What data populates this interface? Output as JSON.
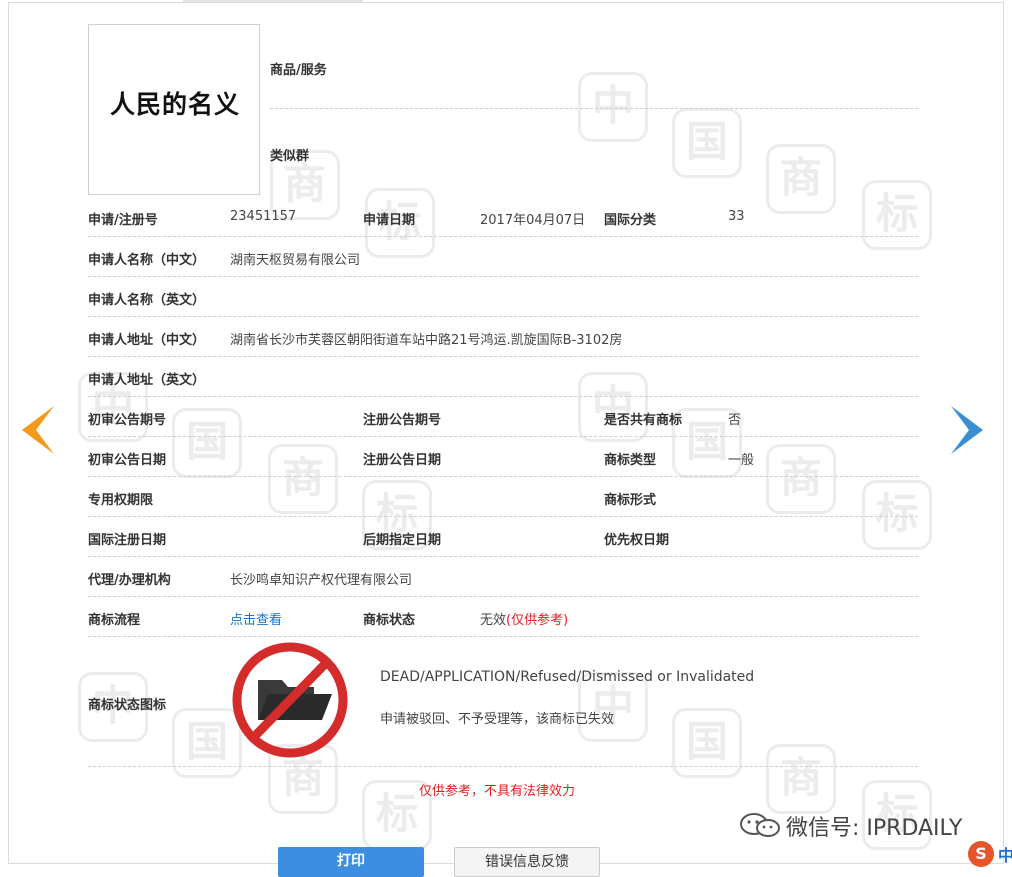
{
  "logo": {
    "text": "人民的名义"
  },
  "goods": {
    "label": "商品/服务",
    "similar_label": "类似群"
  },
  "fields": {
    "reg_no_label": "申请/注册号",
    "reg_no": "23451157",
    "apply_date_label": "申请日期",
    "apply_date": "2017年04月07日",
    "intl_class_label": "国际分类",
    "intl_class": "33",
    "applicant_cn_label": "申请人名称（中文）",
    "applicant_cn": "湖南天枢贸易有限公司",
    "applicant_en_label": "申请人名称（英文）",
    "address_cn_label": "申请人地址（中文）",
    "address_cn": "湖南省长沙市芙蓉区朝阳街道车站中路21号鸿运.凯旋国际B-3102房",
    "address_en_label": "申请人地址（英文）",
    "prelim_no_label": "初审公告期号",
    "reg_pub_no_label": "注册公告期号",
    "shared_label": "是否共有商标",
    "shared": "否",
    "prelim_date_label": "初审公告日期",
    "reg_pub_date_label": "注册公告日期",
    "mark_type_label": "商标类型",
    "mark_type": "一般",
    "exclusive_label": "专用权期限",
    "mark_form_label": "商标形式",
    "intl_reg_date_label": "国际注册日期",
    "later_date_label": "后期指定日期",
    "priority_label": "优先权日期",
    "agent_label": "代理/办理机构",
    "agent": "长沙鸣卓知识产权代理有限公司",
    "flow_label": "商标流程",
    "flow_link": "点击查看",
    "status_label": "商标状态",
    "status": "无效",
    "status_note": "(仅供参考)"
  },
  "status_icon": {
    "label": "商标状态图标",
    "en": "DEAD/APPLICATION/Refused/Dismissed or Invalidated",
    "cn": "申请被驳回、不予受理等，该商标已失效"
  },
  "disclaimer": "仅供参考，不具有法律效力",
  "buttons": {
    "print": "打印",
    "feedback": "错误信息反馈"
  },
  "watermark": {
    "chars": [
      "中",
      "国",
      "商",
      "标"
    ]
  },
  "footer": {
    "wechat": "微信号: IPRDAILY",
    "sogou_s": "S",
    "sogou_zh": "中"
  },
  "colors": {
    "accent_blue": "#3c8fe0",
    "link": "#1a73c7",
    "alert_red": "#e02020",
    "arrow_orange": "#f39a1c",
    "arrow_blue": "#3a8fd0"
  }
}
